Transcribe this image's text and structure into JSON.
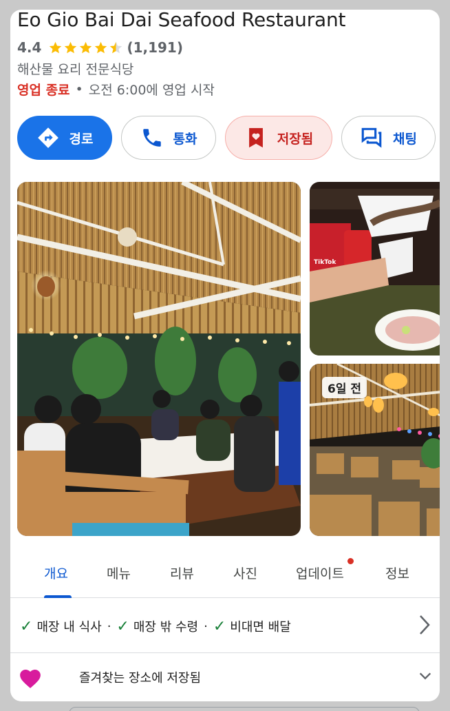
{
  "place": {
    "name": "Eo Gio Bai Dai Seafood Restaurant",
    "rating": "4.4",
    "stars": 4.5,
    "review_count": "(1,191)",
    "category": "해산물 요리 전문식당",
    "status_closed": "영업 종료",
    "status_dot": "•",
    "status_open": "오전 6:00에 영업 시작"
  },
  "actions": {
    "directions": "경로",
    "call": "통화",
    "saved": "저장됨",
    "chat": "채팅"
  },
  "photos": {
    "recent_badge": "6일 전",
    "tiktok_label": "TikTok"
  },
  "tabs": {
    "overview": "개요",
    "menu": "메뉴",
    "reviews": "리뷰",
    "photos": "사진",
    "updates": "업데이트",
    "about": "정보"
  },
  "services": {
    "dine_in": "매장 내 식사",
    "takeout": "매장 밖 수령",
    "delivery": "비대면 배달",
    "separator": "·",
    "check_icon": "✓"
  },
  "favorite": {
    "text": "즐겨찾는 장소에 저장됨",
    "color": "#d81b9d"
  },
  "colors": {
    "primary": "#1a73e8",
    "closed": "#d93025",
    "star": "#fbbc04"
  }
}
